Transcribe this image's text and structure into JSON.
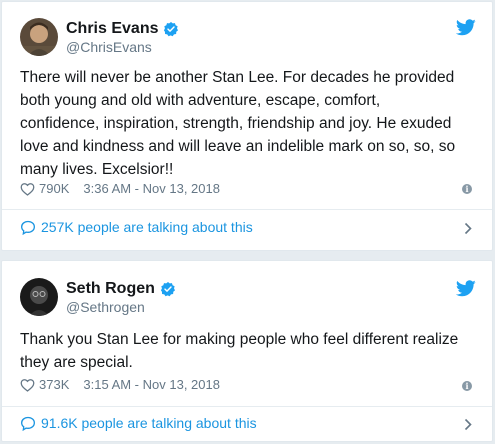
{
  "colors": {
    "link_blue": "#1b95e0",
    "twitter_blue": "#1da1f2",
    "muted": "#657786",
    "text": "#14171a"
  },
  "tweets": [
    {
      "name": "Chris Evans",
      "handle": "@ChrisEvans",
      "verified": true,
      "text": "There will never be another Stan Lee. For decades he provided\nboth young and old with adventure, escape, comfort,\nconfidence, inspiration, strength, friendship and joy. He exuded\nlove and kindness and will leave an indelible mark on so, so, so\nmany lives. Excelsior!!",
      "likes": "790K",
      "timestamp": "3:36 AM - Nov 13, 2018",
      "talking": "257K people are talking about this",
      "icons": [
        "avatar",
        "verified-icon",
        "twitter-bird-icon",
        "heart-icon",
        "info-icon",
        "comment-bubble-icon",
        "chevron-right-icon"
      ]
    },
    {
      "name": "Seth Rogen",
      "handle": "@Sethrogen",
      "verified": true,
      "text": "Thank you Stan Lee for making people who feel different realize\nthey are special.",
      "likes": "373K",
      "timestamp": "3:15 AM - Nov 13, 2018",
      "talking": "91.6K people are talking about this",
      "icons": [
        "avatar",
        "verified-icon",
        "twitter-bird-icon",
        "heart-icon",
        "info-icon",
        "comment-bubble-icon",
        "chevron-right-icon"
      ]
    }
  ]
}
